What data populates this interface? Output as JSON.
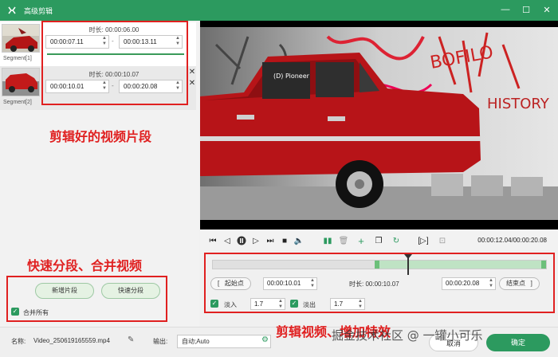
{
  "window": {
    "title": "高级剪辑"
  },
  "segments": [
    {
      "name": "Segment[1]",
      "duration_label": "时长: 00:00:06.00",
      "start": "00:00:07.11",
      "end": "00:00:13.11"
    },
    {
      "name": "Segment[2]",
      "duration_label": "时长: 00:00:10.07",
      "start": "00:00:10.01",
      "end": "00:00:20.08"
    }
  ],
  "annotations": {
    "segments": "剪辑好的视频片段",
    "split_merge": "快速分段、合并视频",
    "edit": "剪辑视频、增加特效"
  },
  "left_buttons": {
    "add_segment": "新增片段",
    "quick_split": "快速分段",
    "merge_all": "合并所有"
  },
  "video": {
    "car_plate_text": "(D) Pioneer"
  },
  "player": {
    "time": "00:00:12.04/00:00:20.08",
    "progress": 0.583
  },
  "timeline": {
    "selection_start": 0.485,
    "selection_end": 1.0
  },
  "range": {
    "start_label": "起始点",
    "start_value": "00:00:10.01",
    "duration_label": "时长: 00:00:10.07",
    "end_value": "00:00:20.08",
    "end_label": "结束点"
  },
  "effects": {
    "fade_in_label": "淡入",
    "fade_in_value": "1.7",
    "fade_out_label": "淡出",
    "fade_out_value": "1.7"
  },
  "bottom": {
    "name_label": "名称:",
    "file_name": "Video_250619165559.mp4",
    "output_label": "输出:",
    "output_value": "自动;Auto",
    "cancel_button": "取消",
    "ok_button": "确定"
  },
  "watermark": "掘金技术社区 @ 一罐小可乐",
  "colors": {
    "accent": "#2c9a5f",
    "annotation": "#e02020"
  }
}
